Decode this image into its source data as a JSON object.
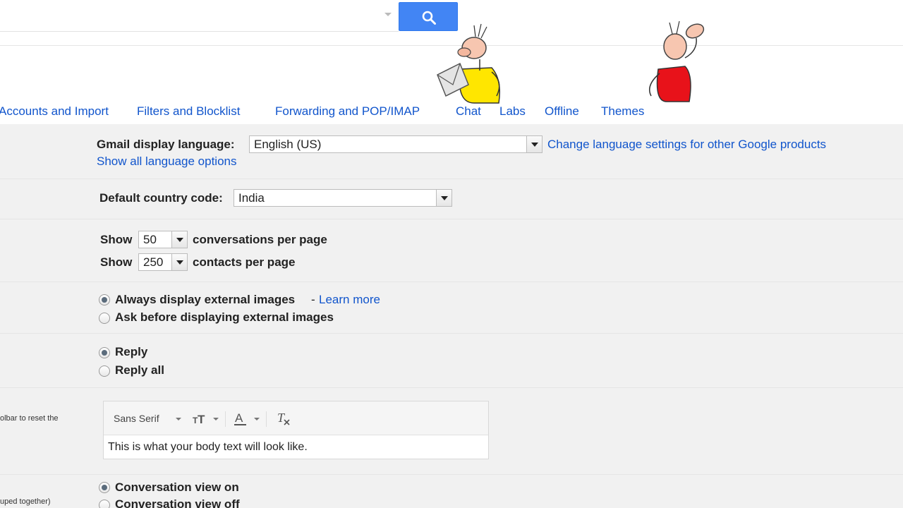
{
  "header": {
    "search": {
      "placeholder": "",
      "button_icon": "search-icon",
      "button_color": "#4285f4"
    }
  },
  "tabs": [
    {
      "label": "Accounts and Import"
    },
    {
      "label": "Filters and Blocklist"
    },
    {
      "label": "Forwarding and POP/IMAP"
    },
    {
      "label": "Chat"
    },
    {
      "label": "Labs"
    },
    {
      "label": "Offline"
    },
    {
      "label": "Themes"
    }
  ],
  "language": {
    "label": "Gmail display language:",
    "value": "English (US)",
    "change_link": "Change language settings for other Google products",
    "show_all_link": "Show all language options"
  },
  "country": {
    "label": "Default country code:",
    "value": "India"
  },
  "page_size": {
    "show_label": "Show",
    "conversations_value": "50",
    "conversations_suffix": "conversations per page",
    "contacts_value": "250",
    "contacts_suffix": "contacts per page"
  },
  "images": {
    "always_label": "Always display external images",
    "separator": "-",
    "learn_more": "Learn more",
    "ask_label": "Ask before displaying external images",
    "selected": "always"
  },
  "reply": {
    "reply_label": "Reply",
    "reply_all_label": "Reply all",
    "selected": "reply"
  },
  "default_text_style": {
    "side_note": "olbar to reset the",
    "font": "Sans Serif",
    "size_icon": "text-size-icon",
    "color_icon": "text-color-icon",
    "clear_icon": "clear-formatting-icon",
    "preview": "This is what your body text will look like."
  },
  "conversation_view": {
    "side_note": "uped together)",
    "on_label": "Conversation view on",
    "off_label": "Conversation view off",
    "selected": "on"
  },
  "colors": {
    "link": "#1155cc",
    "settings_bg": "#f1f1f1",
    "search_button": "#4285f4"
  }
}
